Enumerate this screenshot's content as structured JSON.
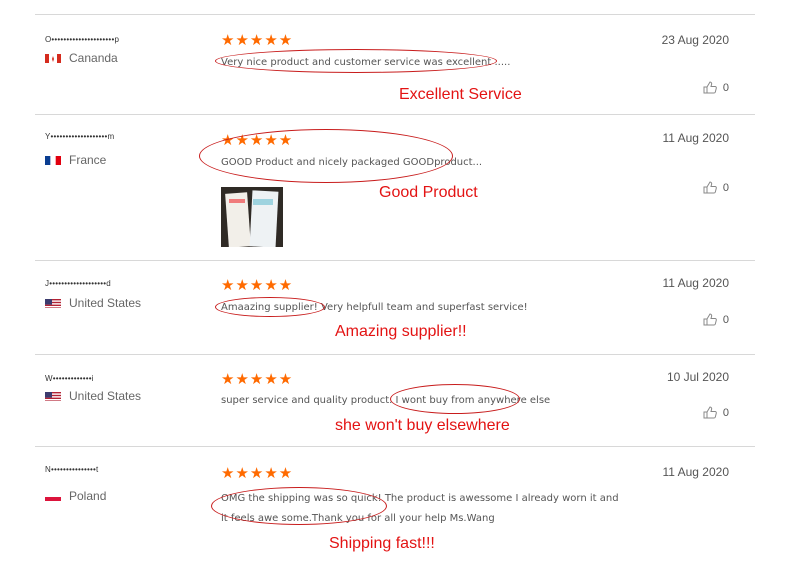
{
  "reviews": [
    {
      "user": "O•••••••••••••••••••••p",
      "country": "Cananda",
      "flag": "canada-flag-icon",
      "stars": "★★★★★",
      "text": "Very nice product and customer service was excellent .....",
      "date": "23 Aug 2020",
      "likes": "0",
      "annotation": "Excellent Service"
    },
    {
      "user": "Y•••••••••••••••••••m",
      "country": "France",
      "flag": "france-flag-icon",
      "stars": "★★★★★",
      "text": "GOOD Product and nicely packaged      GOODproduct...",
      "date": "11 Aug 2020",
      "likes": "0",
      "annotation": "Good Product"
    },
    {
      "user": "J•••••••••••••••••••d",
      "country": "United States",
      "flag": "us-flag-icon",
      "stars": "★★★★★",
      "text": "Amaazing supplier! Very helpfull team and superfast service!",
      "date": "11 Aug 2020",
      "likes": "0",
      "annotation": "Amazing supplier!!"
    },
    {
      "user": "W•••••••••••••i",
      "country": "United States",
      "flag": "us-flag-icon",
      "stars": "★★★★★",
      "text": "super service and quality product. I wont buy from anywhere else",
      "date": "10 Jul 2020",
      "likes": "0",
      "annotation": "she won't buy elsewhere"
    },
    {
      "user": "N•••••••••••••••t",
      "country": "Poland",
      "flag": "poland-flag-icon",
      "stars": "★★★★★",
      "text": "OMG the shipping was so quick! The product is awessome I already worn it and it feels awe some.Thank you for all your help Ms.Wang",
      "date": "11 Aug 2020",
      "likes": "",
      "annotation": "Shipping fast!!!"
    }
  ],
  "colors": {
    "star": "#ff6a00",
    "annotation": "#e31313",
    "ellipse": "#c81d1d"
  }
}
